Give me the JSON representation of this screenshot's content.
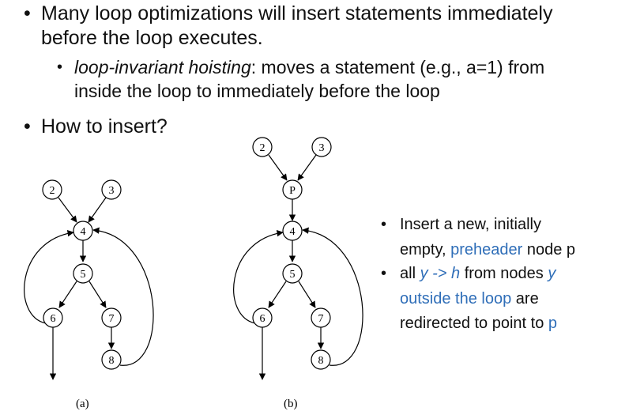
{
  "bullets": {
    "b1": {
      "line1": "Many loop optimizations will insert statements immediately",
      "line2": "before the loop executes."
    },
    "b1_sub": {
      "term": "loop-invariant hoisting",
      "line1_rest": ": moves a statement (e.g., a=1) from",
      "line2": "inside the loop to immediately before the loop"
    },
    "b2": "How to insert?"
  },
  "right_bullets": {
    "r1": {
      "line1": "Insert a new, initially",
      "line2_pre": "empty, ",
      "line2_blue": "preheader",
      "line2_post": " node p"
    },
    "r2": {
      "line1_pre": "all ",
      "line1_blue": "y -> h",
      "line1_mid": " from nodes ",
      "line1_blue2": "y",
      "line2_blue": "outside the loop",
      "line2_post": " are",
      "line3_pre": "redirected to point to ",
      "line3_blue": "p"
    }
  },
  "diagram_a": {
    "nodes": [
      "2",
      "3",
      "4",
      "5",
      "6",
      "7",
      "8"
    ],
    "caption": "(a)"
  },
  "diagram_b": {
    "nodes": [
      "2",
      "3",
      "P",
      "4",
      "5",
      "6",
      "7",
      "8"
    ],
    "caption": "(b)"
  },
  "colors": {
    "accent_blue": "#2f6eb8"
  }
}
